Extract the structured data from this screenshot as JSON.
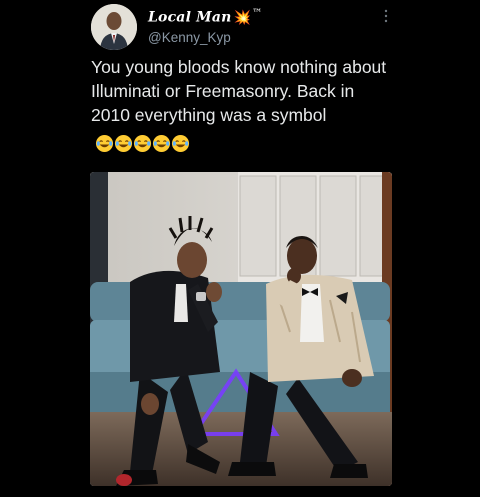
{
  "user": {
    "display_name": "Local Man",
    "name_emoji": "💥",
    "trademark": "™",
    "handle": "@Kenny_Kyp"
  },
  "tweet": {
    "text": "You young bloods know nothing about Illuminati or Freemasonry. Back in 2010 everything was a symbol",
    "emoji": [
      "face-with-tears-of-joy",
      "face-with-tears-of-joy",
      "face-with-tears-of-joy",
      "face-with-tears-of-joy",
      "face-with-tears-of-joy"
    ]
  },
  "icons": {
    "more": "more-icon",
    "avatar": "avatar",
    "media": "tweet-photo"
  },
  "colors": {
    "background": "#000000",
    "text": "#e7e9ea",
    "handle": "#8b98a5",
    "neon_triangle": "#7a3cff"
  }
}
